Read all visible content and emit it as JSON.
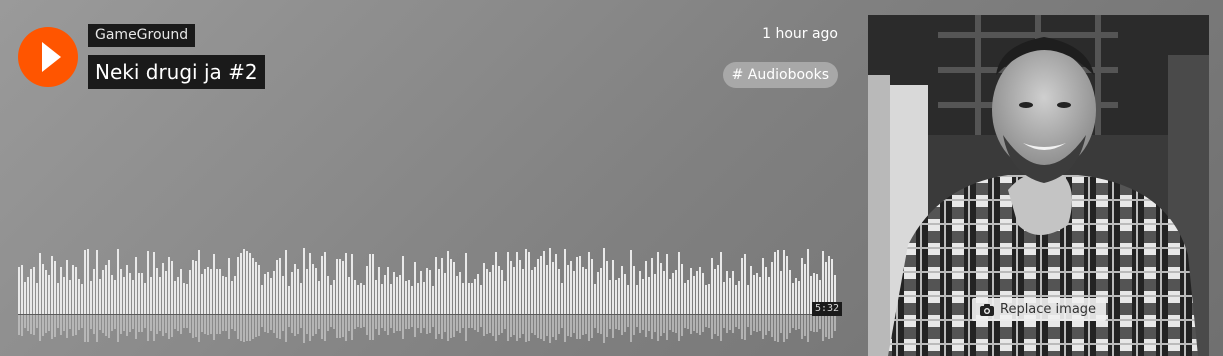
{
  "track": {
    "artist": "GameGround",
    "title": "Neki drugi ja #2",
    "posted": "1 hour ago",
    "tag": "# Audiobooks",
    "duration": "5:32"
  },
  "artwork": {
    "replace_label": "Replace image",
    "camera_icon": "camera-icon"
  },
  "colors": {
    "accent": "#ff5500",
    "label_bg": "#1a1a1a",
    "tag_bg": "#a8a8a8",
    "wave": "#e9e9e9"
  },
  "icons": {
    "play": "play-icon"
  }
}
